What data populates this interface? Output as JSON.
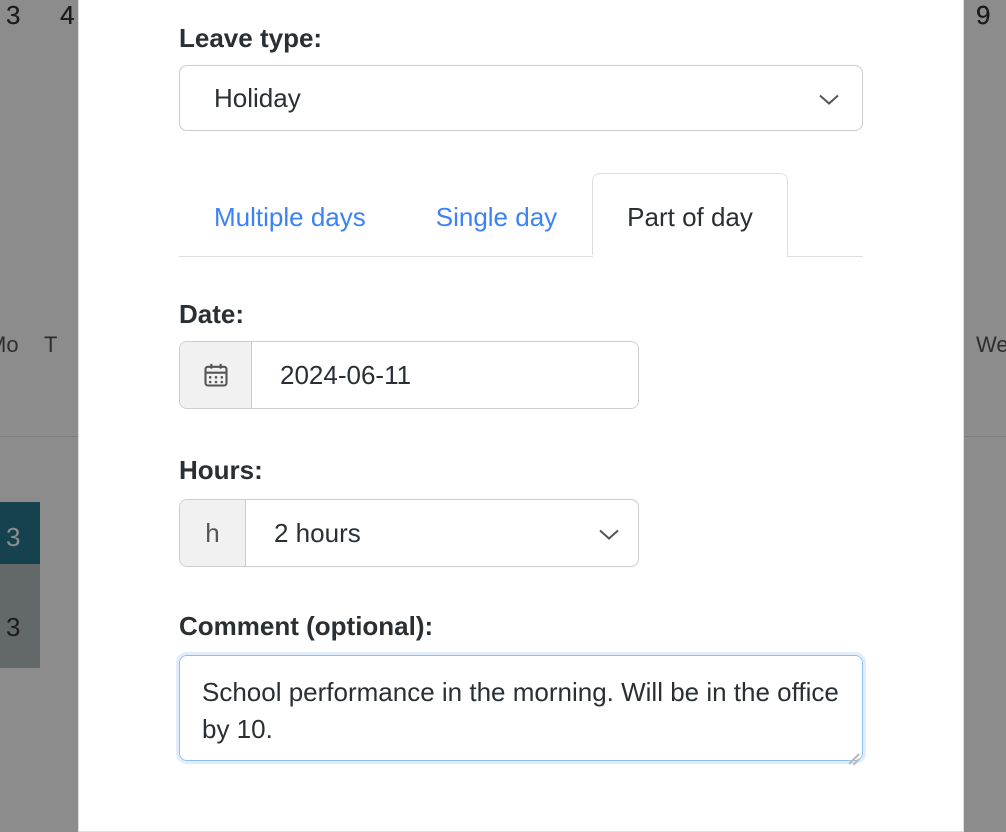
{
  "background": {
    "weekday_mo": "Mo",
    "weekday_tu": "T",
    "weekday_we": "We",
    "col1": "3",
    "col2": "4",
    "col3": "9"
  },
  "form": {
    "leave_type_label": "Leave type:",
    "leave_type_value": "Holiday",
    "tabs": {
      "multiple": "Multiple days",
      "single": "Single day",
      "part": "Part of day"
    },
    "date_label": "Date:",
    "date_value": "2024-06-11",
    "hours_label": "Hours:",
    "hours_prefix": "h",
    "hours_value": "2 hours",
    "comment_label": "Comment (optional):",
    "comment_value": "School performance in the morning. Will be in the office by 10."
  }
}
